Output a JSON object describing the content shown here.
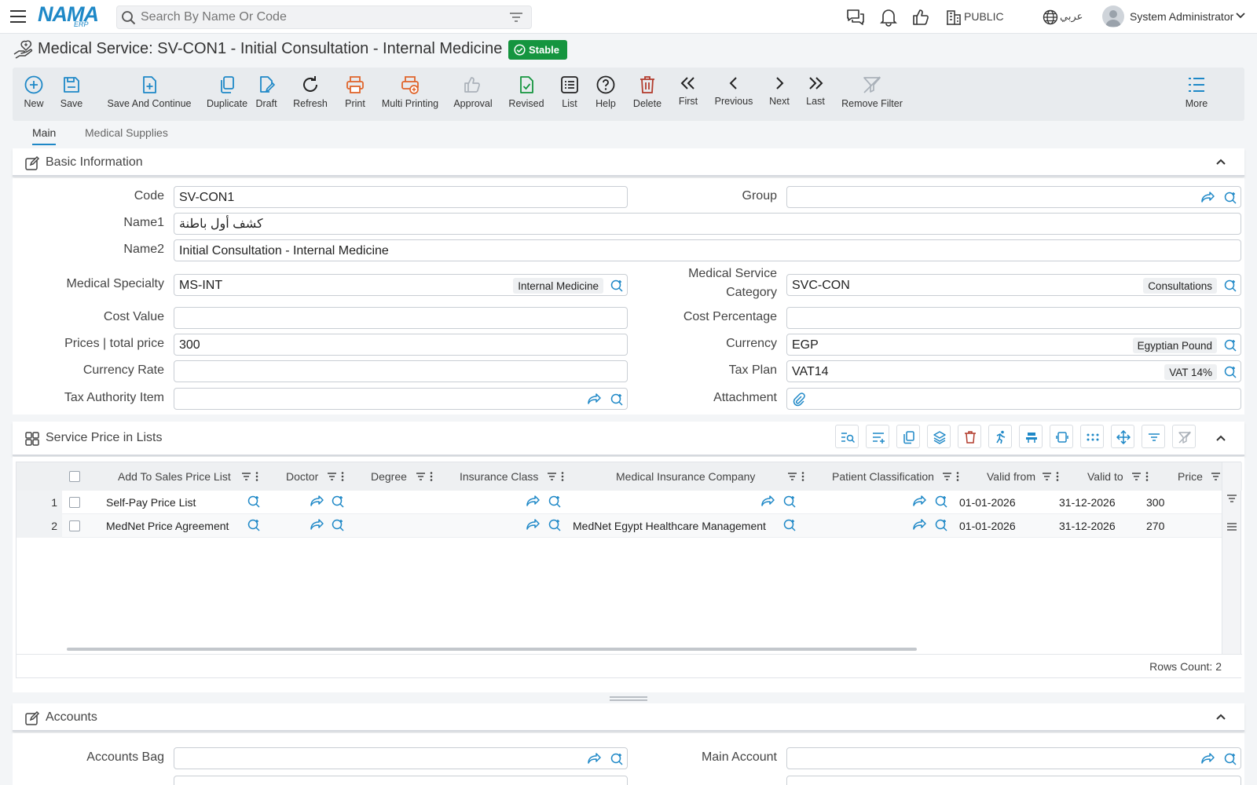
{
  "app": {
    "logo": "NAMA",
    "logo_sub": "ERP"
  },
  "search": {
    "placeholder": "Search By Name Or Code"
  },
  "topbar": {
    "public_label": "PUBLIC",
    "lang_label": "عربي",
    "user_name": "System Administrator"
  },
  "page": {
    "title": "Medical Service: SV-CON1 - Initial Consultation - Internal Medicine",
    "status": "Stable"
  },
  "toolbar": {
    "new": "New",
    "save": "Save",
    "save_continue": "Save And Continue",
    "duplicate": "Duplicate",
    "draft": "Draft",
    "refresh": "Refresh",
    "print": "Print",
    "multi_printing": "Multi Printing",
    "approval": "Approval",
    "revised": "Revised",
    "list": "List",
    "help": "Help",
    "delete": "Delete",
    "first": "First",
    "previous": "Previous",
    "next": "Next",
    "last": "Last",
    "remove_filter": "Remove Filter",
    "more": "More"
  },
  "tabs": {
    "main": "Main",
    "medical_supplies": "Medical Supplies"
  },
  "basic": {
    "title": "Basic Information",
    "code_label": "Code",
    "code_value": "SV-CON1",
    "group_label": "Group",
    "group_value": "",
    "name1_label": "Name1",
    "name1_value": "كشف أول باطنة",
    "name2_label": "Name2",
    "name2_value": "Initial Consultation - Internal Medicine",
    "specialty_label": "Medical Specialty",
    "specialty_value": "MS-INT",
    "specialty_tag": "Internal Medicine",
    "category_label_1": "Medical Service",
    "category_label_2": "Category",
    "category_value": "SVC-CON",
    "category_tag": "Consultations",
    "cost_value_label": "Cost Value",
    "cost_value": "",
    "cost_pct_label": "Cost Percentage",
    "cost_pct": "",
    "price_label": "Prices | total price",
    "price_value": "300",
    "currency_label": "Currency",
    "currency_value": "EGP",
    "currency_tag": "Egyptian Pound",
    "rate_label": "Currency Rate",
    "rate_value": "",
    "tax_plan_label": "Tax Plan",
    "tax_plan_value": "VAT14",
    "tax_plan_tag": "VAT 14%",
    "tax_item_label": "Tax Authority Item",
    "tax_item_value": "",
    "attachment_label": "Attachment"
  },
  "prices": {
    "title": "Service Price in Lists",
    "columns": [
      "Add To Sales Price List",
      "Doctor",
      "Degree",
      "Insurance Class",
      "Medical Insurance Company",
      "Patient Classification",
      "Valid from",
      "Valid to",
      "Price"
    ],
    "rows": [
      {
        "num": "1",
        "list": "Self-Pay Price List",
        "doctor": "",
        "degree": "",
        "ins_class": "",
        "company": "",
        "patient_class": "",
        "from": "01-01-2026",
        "to": "31-12-2026",
        "price": "300"
      },
      {
        "num": "2",
        "list": "MedNet Price Agreement",
        "doctor": "",
        "degree": "",
        "ins_class": "",
        "company": "MedNet Egypt Healthcare Management",
        "patient_class": "",
        "from": "01-01-2026",
        "to": "31-12-2026",
        "price": "270"
      }
    ],
    "rows_count": "Rows Count: 2"
  },
  "accounts": {
    "title": "Accounts",
    "bag_label": "Accounts Bag",
    "main_label": "Main Account"
  },
  "colors": {
    "accent": "#1e88c7",
    "stable": "#15953f",
    "delete": "#b23b2c",
    "print": "#e0642a"
  }
}
